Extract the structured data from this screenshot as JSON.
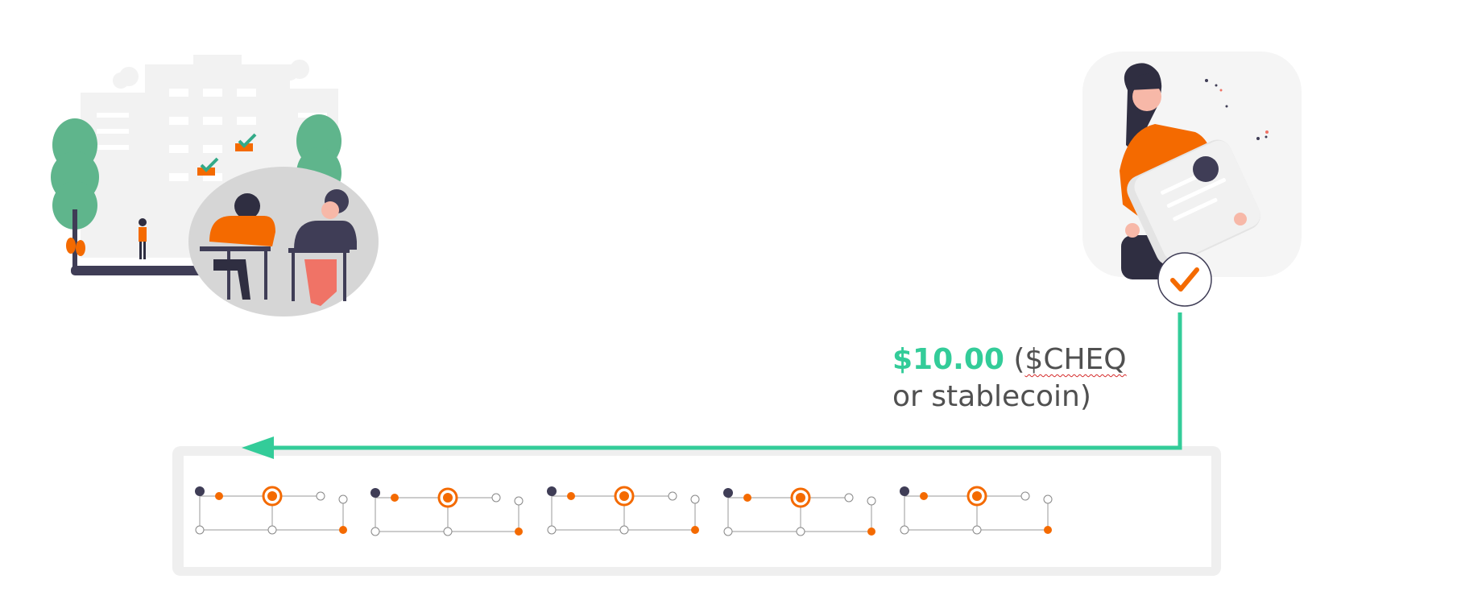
{
  "payment": {
    "amount": "$10.00",
    "currency_note_open": " (",
    "currency_note": "$CHEQ",
    "currency_rest": " or stablecoin)"
  },
  "colors": {
    "accent_green": "#33cc99",
    "brand_orange": "#f46a00",
    "dark": "#3f3d56",
    "light_gray": "#efefef",
    "text_gray": "#505050"
  },
  "icons": {
    "issuer": "students-exam-illustration",
    "holder": "woman-holding-credential-illustration",
    "verified": "checkmark-badge-icon",
    "ledger": "blockchain-ledger-diagram",
    "token": "cheqd-token-icon",
    "identity": "identity-node-icon"
  }
}
